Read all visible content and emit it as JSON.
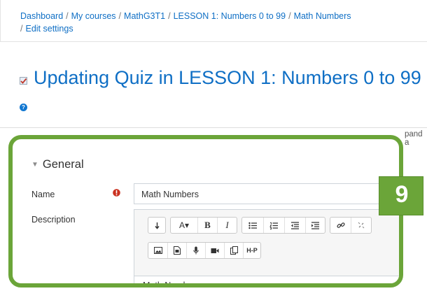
{
  "breadcrumb": {
    "items": [
      "Dashboard",
      "My courses",
      "MathG3T1",
      "LESSON 1: Numbers 0 to 99",
      "Math Numbers",
      "Edit settings"
    ],
    "separator": "/"
  },
  "page": {
    "title": "Updating Quiz in LESSON 1: Numbers 0 to 99",
    "help_icon_glyph": "?",
    "expand_all_partial": "pand a"
  },
  "form": {
    "section_title": "General",
    "name_label": "Name",
    "name_value": "Math Numbers",
    "required_icon_glyph": "!",
    "description_label": "Description",
    "description_value": "Math Numbers"
  },
  "editor_toolbar": {
    "row1": [
      "collapse-icon",
      "font-style-icon",
      "bold-icon",
      "italic-icon",
      "unordered-list-icon",
      "ordered-list-icon",
      "outdent-icon",
      "indent-icon",
      "link-icon",
      "unlink-icon"
    ],
    "row2": [
      "image-icon",
      "media-icon",
      "record-audio-icon",
      "record-video-icon",
      "manage-files-icon",
      "h5p-icon"
    ],
    "font_style_label": "A▾",
    "bold_label": "B",
    "italic_label": "I",
    "h5p_label": "H-P"
  },
  "annotation": {
    "step_number": "9",
    "color": "#6ba539"
  },
  "colors": {
    "link": "#0f6fc5",
    "required": "#ca3120",
    "help": "#1177d1"
  }
}
